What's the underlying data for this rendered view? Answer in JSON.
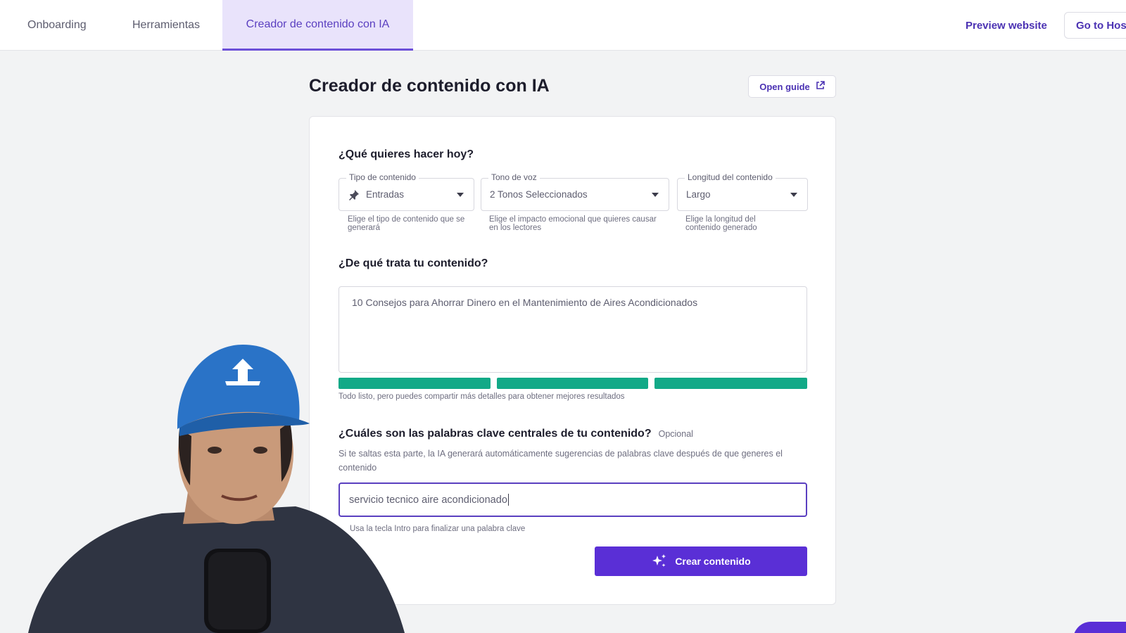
{
  "nav": {
    "tabs": [
      {
        "label": "Onboarding"
      },
      {
        "label": "Herramientas"
      },
      {
        "label": "Creador de contenido con IA"
      }
    ],
    "preview_label": "Preview website",
    "goto_label": "Go to Host"
  },
  "page": {
    "title": "Creador de contenido con IA",
    "guide_label": "Open guide"
  },
  "form": {
    "q1": "¿Qué quieres hacer hoy?",
    "tipo": {
      "label": "Tipo de contenido",
      "value": "Entradas",
      "helper": "Elige el tipo de contenido que se generará",
      "icon": "pin-icon"
    },
    "tono": {
      "label": "Tono de voz",
      "value": "2 Tonos Seleccionados",
      "helper": "Elige el impacto emocional que quieres causar en los lectores"
    },
    "longitud": {
      "label": "Longitud del contenido",
      "value": "Largo",
      "helper": "Elige la longitud del contenido generado"
    },
    "q2": "¿De qué trata tu contenido?",
    "topic": "10 Consejos para Ahorrar Dinero en el Mantenimiento de Aires Acondicionados",
    "progress": {
      "filled_segments": 3,
      "total_segments": 3,
      "color": "#12a987"
    },
    "status": "Todo listo, pero puedes compartir más detalles para obtener mejores resultados",
    "q3": "¿Cuáles son las palabras clave centrales de tu contenido?",
    "optional": "Opcional",
    "keywords_desc": "Si te saltas esta parte, la IA generará automáticamente sugerencias de palabras clave después de que generes el contenido",
    "keyword_value": "servicio tecnico aire acondicionado",
    "keyword_hint": "Usa la tecla Intro para finalizar una palabra clave",
    "create_label": "Crear contenido"
  },
  "colors": {
    "accent": "#5a2fd6",
    "active_tab_bg": "#e9e3fb",
    "progress": "#12a987"
  }
}
